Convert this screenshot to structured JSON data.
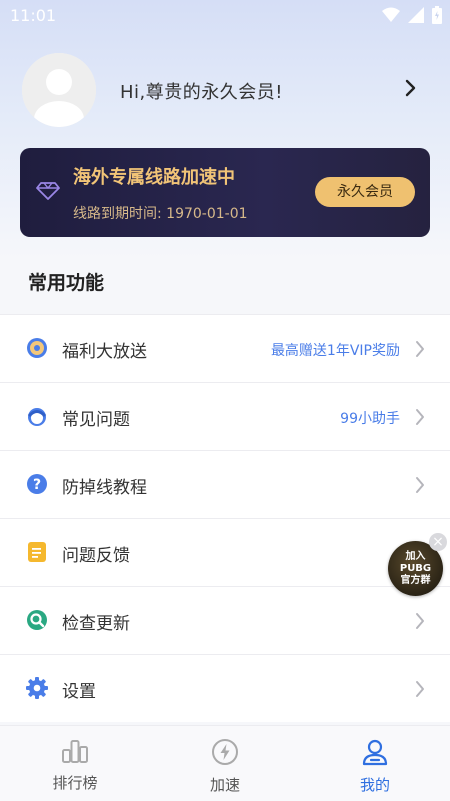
{
  "status_bar": {
    "time": "11:01"
  },
  "profile": {
    "greeting": "Hi,尊贵的永久会员!"
  },
  "vip_card": {
    "title": "海外专属线路加速中",
    "expire_label": "线路到期时间: 1970-01-01",
    "button_label": "永久会员"
  },
  "section_title": "常用功能",
  "menu": [
    {
      "label": "福利大放送",
      "right_text": "最高赠送1年VIP奖励"
    },
    {
      "label": "常见问题",
      "right_text": "99小助手"
    },
    {
      "label": "防掉线教程",
      "right_text": ""
    },
    {
      "label": "问题反馈",
      "right_text": ""
    },
    {
      "label": "检查更新",
      "right_text": ""
    },
    {
      "label": "设置",
      "right_text": ""
    }
  ],
  "floating_badge": {
    "line1": "加入",
    "line2": "PUBG",
    "line3": "官方群"
  },
  "bottom_nav": [
    {
      "label": "排行榜"
    },
    {
      "label": "加速"
    },
    {
      "label": "我的"
    }
  ],
  "colors": {
    "accent": "#2f6fe0",
    "vip_gold": "#efc170",
    "vip_card_bg": "#1f1d3e"
  }
}
